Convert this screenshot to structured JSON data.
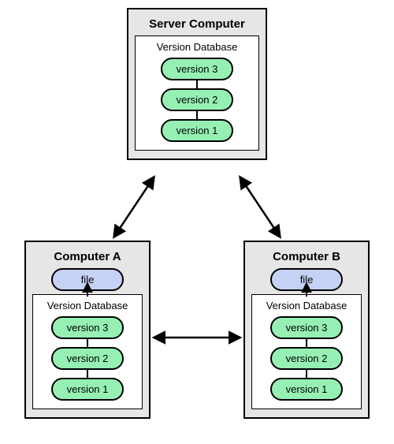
{
  "server": {
    "title": "Server Computer",
    "db_title": "Version Database",
    "versions": [
      "version 3",
      "version 2",
      "version 1"
    ]
  },
  "clientA": {
    "title": "Computer A",
    "file_label": "file",
    "db_title": "Version Database",
    "versions": [
      "version 3",
      "version 2",
      "version 1"
    ]
  },
  "clientB": {
    "title": "Computer B",
    "file_label": "file",
    "db_title": "Version Database",
    "versions": [
      "version 3",
      "version 2",
      "version 1"
    ]
  }
}
